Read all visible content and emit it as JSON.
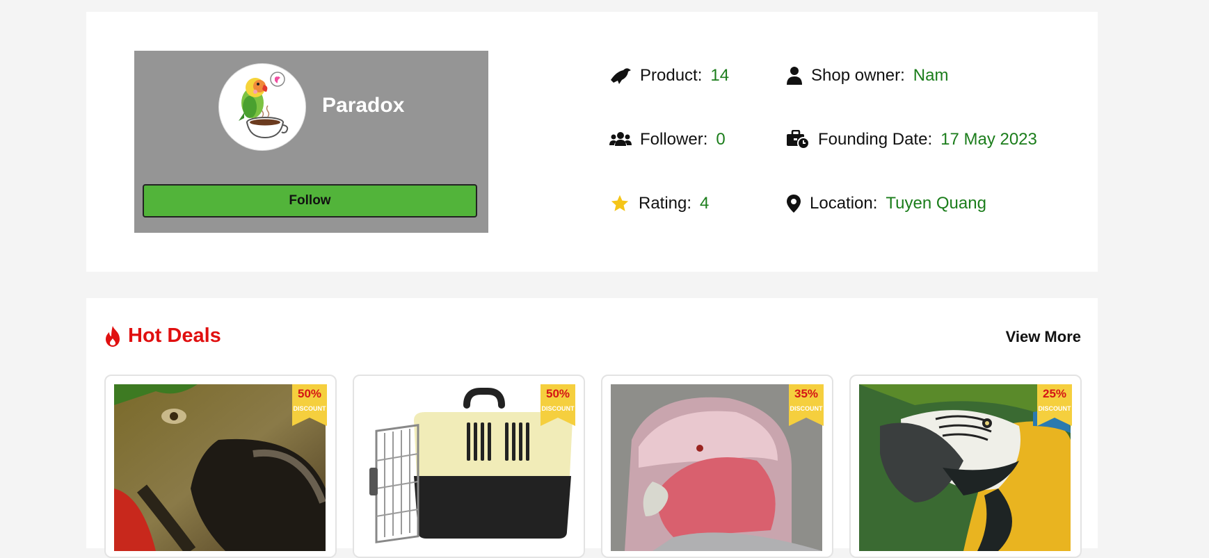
{
  "shop": {
    "name": "Paradox",
    "follow_label": "Follow"
  },
  "stats": {
    "product": {
      "label": "Product:",
      "value": "14",
      "icon": "bird-icon"
    },
    "owner": {
      "label": "Shop owner:",
      "value": "Nam",
      "icon": "user-icon"
    },
    "follower": {
      "label": "Follower:",
      "value": "0",
      "icon": "users-icon"
    },
    "founding": {
      "label": "Founding Date:",
      "value": "17 May 2023",
      "icon": "briefcase-clock-icon"
    },
    "rating": {
      "label": "Rating:",
      "value": "4",
      "icon": "star-icon"
    },
    "location": {
      "label": "Location:",
      "value": "Tuyen Quang",
      "icon": "map-pin-icon"
    }
  },
  "deals": {
    "title": "Hot Deals",
    "view_more": "View More",
    "discount_label": "DISCOUNT",
    "items": [
      {
        "discount": "50%",
        "image": "macaw-closeup-photo"
      },
      {
        "discount": "50%",
        "image": "pet-carrier-photo"
      },
      {
        "discount": "35%",
        "image": "galah-cockatoo-photo"
      },
      {
        "discount": "25%",
        "image": "blue-gold-macaw-photo"
      }
    ]
  },
  "colors": {
    "value_green": "#1b7d1b",
    "follow_green": "#52b43a",
    "hot_red": "#e01010",
    "badge_yellow": "#f5cf3e",
    "card_gray": "#959595"
  }
}
